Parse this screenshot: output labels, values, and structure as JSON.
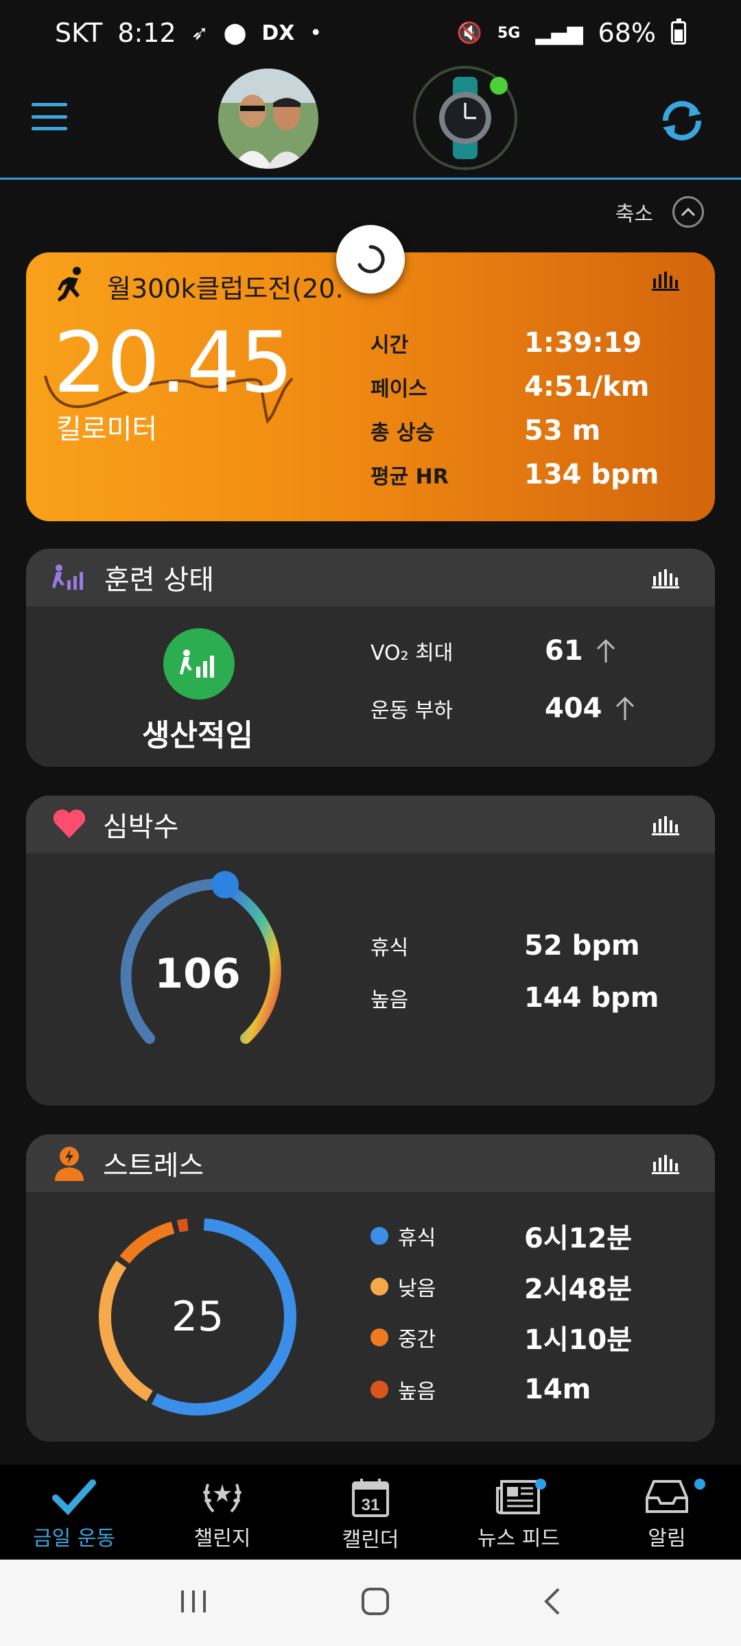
{
  "status_bar": {
    "carrier": "SKT",
    "time": "8:12",
    "network": "5G",
    "battery": "68%"
  },
  "header": {
    "collapse_label": "축소"
  },
  "activity": {
    "title": "월300k클럽도전(20.",
    "distance": "20.45",
    "distance_unit": "킬로미터",
    "metrics": [
      {
        "label": "시간",
        "value": "1:39:19"
      },
      {
        "label": "페이스",
        "value": "4:51/km"
      },
      {
        "label": "총 상승",
        "value": "53 m"
      },
      {
        "label": "평균 HR",
        "value": "134 bpm"
      }
    ]
  },
  "training": {
    "title": "훈련 상태",
    "status": "생산적임",
    "vo2_label": "VO₂ 최대",
    "vo2_value": "61",
    "load_label": "운동 부하",
    "load_value": "404"
  },
  "heart_rate": {
    "title": "심박수",
    "current": "106",
    "rest_label": "휴식",
    "rest_value": "52 bpm",
    "high_label": "높음",
    "high_value": "144 bpm"
  },
  "stress": {
    "title": "스트레스",
    "value": "25",
    "rows": [
      {
        "label": "휴식",
        "value": "6시12분",
        "color": "#3b8fe8"
      },
      {
        "label": "낮음",
        "value": "2시48분",
        "color": "#f6a94a"
      },
      {
        "label": "중간",
        "value": "1시10분",
        "color": "#ef7a1e"
      },
      {
        "label": "높음",
        "value": "14m",
        "color": "#d9561a"
      }
    ]
  },
  "bottom_nav": [
    {
      "label": "금일 운동",
      "icon": "check-icon",
      "active": true
    },
    {
      "label": "챌린지",
      "icon": "laurel-icon"
    },
    {
      "label": "캘린더",
      "icon": "calendar-icon",
      "date": "31"
    },
    {
      "label": "뉴스 피드",
      "icon": "newspaper-icon"
    },
    {
      "label": "알림",
      "icon": "inbox-icon"
    }
  ],
  "colors": {
    "accent": "#3aa6e0",
    "activity_orange": "#f08a12",
    "training_green": "#2cad4f",
    "heart": "#ff4d6d"
  }
}
